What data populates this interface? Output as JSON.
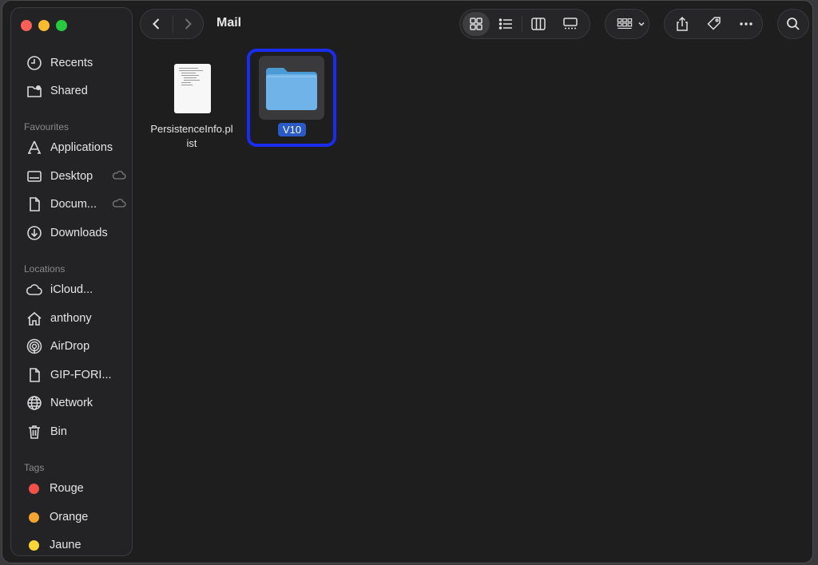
{
  "window": {
    "title": "Mail"
  },
  "traffic_lights": {
    "close": "#ff5f57",
    "minimize": "#febc2e",
    "zoom": "#28c840"
  },
  "sidebar": {
    "top_items": [
      {
        "label": "Recents",
        "icon": "clock-icon"
      },
      {
        "label": "Shared",
        "icon": "shared-folder-icon"
      }
    ],
    "favourites_header": "Favourites",
    "favourites": [
      {
        "label": "Applications",
        "icon": "applications-icon"
      },
      {
        "label": "Desktop",
        "icon": "desktop-icon",
        "icloud": true
      },
      {
        "label": "Docum...",
        "icon": "document-icon",
        "icloud": true
      },
      {
        "label": "Downloads",
        "icon": "downloads-icon"
      }
    ],
    "locations_header": "Locations",
    "locations": [
      {
        "label": "iCloud...",
        "icon": "cloud-icon"
      },
      {
        "label": "anthony",
        "icon": "home-icon"
      },
      {
        "label": "AirDrop",
        "icon": "airdrop-icon"
      },
      {
        "label": "GIP-FORI...",
        "icon": "document-icon"
      },
      {
        "label": "Network",
        "icon": "globe-icon"
      },
      {
        "label": "Bin",
        "icon": "trash-icon"
      }
    ],
    "tags_header": "Tags",
    "tags": [
      {
        "label": "Rouge",
        "color": "#f0524a"
      },
      {
        "label": "Orange",
        "color": "#f5a431"
      },
      {
        "label": "Jaune",
        "color": "#f7d63a"
      }
    ]
  },
  "toolbar": {
    "view_modes": [
      "icon-view",
      "list-view",
      "column-view",
      "gallery-view"
    ],
    "selected_view": "icon-view"
  },
  "files": [
    {
      "name": "PersistenceInfo.plist",
      "name_line1": "PersistenceInfo.pl",
      "name_line2": "ist",
      "type": "plist-document",
      "selected": false
    },
    {
      "name": "V10",
      "type": "folder",
      "selected": true
    }
  ],
  "accent": {
    "selection": "#2a5ac5",
    "highlight_border": "#1a2cf0",
    "folder": "#6fb3e8"
  }
}
